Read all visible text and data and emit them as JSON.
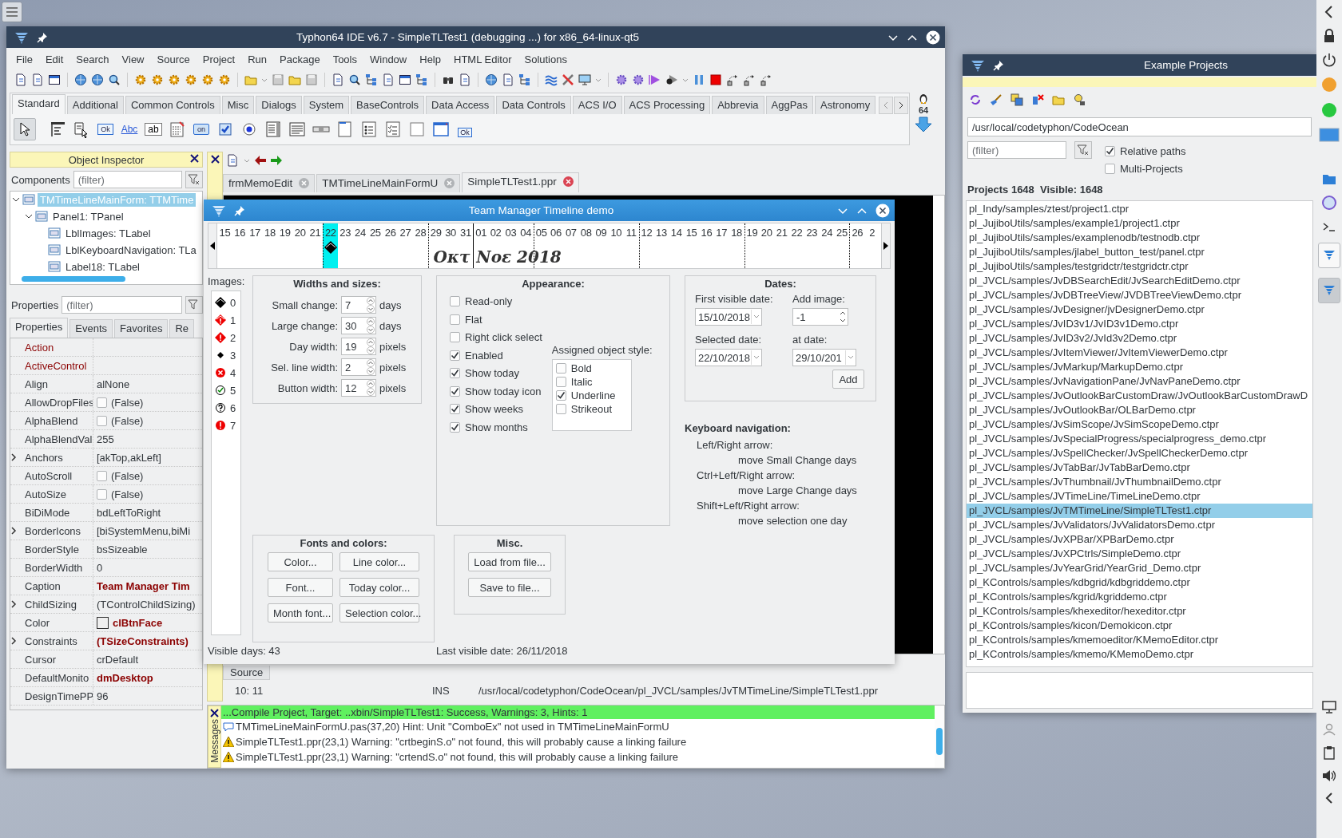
{
  "ide": {
    "title": "Typhon64 IDE v6.7 - SimpleTLTest1 (debugging ...) for x86_64-linux-qt5",
    "menu": [
      "File",
      "Edit",
      "Search",
      "View",
      "Source",
      "Project",
      "Run",
      "Package",
      "Tools",
      "Window",
      "Help",
      "HTML Editor",
      "Solutions"
    ],
    "palette_tabs": [
      {
        "label": "Standard",
        "selected": true
      },
      {
        "label": "Additional",
        "selected": false
      },
      {
        "label": "Common Controls",
        "selected": false
      },
      {
        "label": "Misc",
        "selected": false
      },
      {
        "label": "Dialogs",
        "selected": false
      },
      {
        "label": "System",
        "selected": false
      },
      {
        "label": "BaseControls",
        "selected": false
      },
      {
        "label": "Data Access",
        "selected": false
      },
      {
        "label": "Data Controls",
        "selected": false
      },
      {
        "label": "ACS I/O",
        "selected": false
      },
      {
        "label": "ACS Processing",
        "selected": false
      },
      {
        "label": "Abbrevia",
        "selected": false
      },
      {
        "label": "AggPas",
        "selected": false
      },
      {
        "label": "Astronomy",
        "selected": false
      }
    ],
    "palette_items": [
      {
        "kind": "pointer",
        "selected": true
      },
      {
        "kind": "menu",
        "selected": false
      },
      {
        "kind": "popup",
        "selected": false
      },
      {
        "kind": "button",
        "label": "Ok",
        "selected": false
      },
      {
        "kind": "text",
        "label": "Abc",
        "selected": false
      },
      {
        "kind": "edit",
        "label": "ab",
        "selected": false
      },
      {
        "kind": "memo",
        "selected": false
      },
      {
        "kind": "toggle",
        "label": "on",
        "selected": false
      },
      {
        "kind": "check",
        "selected": false
      },
      {
        "kind": "radio",
        "selected": false
      },
      {
        "kind": "listbox",
        "selected": false
      },
      {
        "kind": "combo",
        "selected": false
      },
      {
        "kind": "scrollbar",
        "selected": false
      },
      {
        "kind": "groupbox",
        "selected": false
      },
      {
        "kind": "radiogroup",
        "selected": false
      },
      {
        "kind": "checkgroup",
        "selected": false
      },
      {
        "kind": "panel",
        "selected": false
      },
      {
        "kind": "frame",
        "selected": false
      },
      {
        "kind": "actionlist",
        "label": "Ok",
        "selected": false
      }
    ],
    "target_badge": "64",
    "inspector": {
      "title": "Object Inspector",
      "components_label": "Components",
      "components_filter": {
        "placeholder": "(filter)"
      },
      "tree": [
        {
          "label": "TMTimeLineMainForm: TTMTime",
          "selected": true,
          "expanded": true,
          "children": [
            {
              "label": "Panel1: TPanel",
              "selected": false,
              "expanded": true,
              "children": [
                {
                  "label": "LblImages: TLabel",
                  "selected": false
                },
                {
                  "label": "LblKeyboardNavigation: TLa",
                  "selected": false
                },
                {
                  "label": "Label18: TLabel",
                  "selected": false
                }
              ]
            }
          ]
        }
      ],
      "properties_label": "Properties",
      "properties_filter": {
        "placeholder": "(filter)"
      },
      "tabs": [
        {
          "label": "Properties",
          "selected": true
        },
        {
          "label": "Events",
          "selected": false
        },
        {
          "label": "Favorites",
          "selected": false
        },
        {
          "label": "Re",
          "selected": false
        }
      ],
      "rows": [
        {
          "name": "Action",
          "kind": "empty",
          "special": true,
          "expandable": false
        },
        {
          "name": "ActiveControl",
          "kind": "empty",
          "special": true,
          "expandable": false
        },
        {
          "name": "Align",
          "kind": "text",
          "value": "alNone",
          "special": false,
          "expandable": false
        },
        {
          "name": "AllowDropFiles",
          "kind": "check",
          "checked": false,
          "value": "(False)",
          "special": false,
          "expandable": false
        },
        {
          "name": "AlphaBlend",
          "kind": "check",
          "checked": false,
          "value": "(False)",
          "special": false,
          "expandable": false
        },
        {
          "name": "AlphaBlendVal",
          "kind": "text",
          "value": "255",
          "special": false,
          "expandable": false
        },
        {
          "name": "Anchors",
          "kind": "text",
          "value": "[akTop,akLeft]",
          "special": false,
          "expandable": true
        },
        {
          "name": "AutoScroll",
          "kind": "check",
          "checked": false,
          "value": "(False)",
          "special": false,
          "expandable": false
        },
        {
          "name": "AutoSize",
          "kind": "check",
          "checked": false,
          "value": "(False)",
          "special": false,
          "expandable": false
        },
        {
          "name": "BiDiMode",
          "kind": "text",
          "value": "bdLeftToRight",
          "special": false,
          "expandable": false
        },
        {
          "name": "BorderIcons",
          "kind": "text",
          "value": "[biSystemMenu,biMi",
          "special": false,
          "expandable": true
        },
        {
          "name": "BorderStyle",
          "kind": "text",
          "value": "bsSizeable",
          "special": false,
          "expandable": false
        },
        {
          "name": "BorderWidth",
          "kind": "text",
          "value": "0",
          "special": false,
          "expandable": false
        },
        {
          "name": "Caption",
          "kind": "bold",
          "value": "Team Manager Tim",
          "special": false,
          "expandable": false
        },
        {
          "name": "ChildSizing",
          "kind": "text",
          "value": "(TControlChildSizing)",
          "special": false,
          "expandable": true
        },
        {
          "name": "Color",
          "kind": "color",
          "value": "clBtnFace",
          "special": false,
          "expandable": false
        },
        {
          "name": "Constraints",
          "kind": "bold",
          "value": "(TSizeConstraints)",
          "special": false,
          "expandable": true
        },
        {
          "name": "Cursor",
          "kind": "text",
          "value": "crDefault",
          "special": false,
          "expandable": false
        },
        {
          "name": "DefaultMonito",
          "kind": "bold",
          "value": "dmDesktop",
          "special": false,
          "expandable": false
        },
        {
          "name": "DesignTimePP",
          "kind": "text",
          "value": "96",
          "special": false,
          "expandable": false
        }
      ]
    },
    "editor": {
      "tabs": [
        {
          "label": "frmMemoEdit",
          "selected": false
        },
        {
          "label": "TMTimeLineMainFormU",
          "selected": false
        },
        {
          "label": "SimpleTLTest1.ppr",
          "selected": true
        }
      ],
      "source_tab": "Source",
      "status": {
        "position": "10: 11",
        "mode": "INS",
        "path": "/usr/local/codetyphon/CodeOcean/pl_JVCL/samples/JvTMTimeLine/SimpleTLTest1.ppr"
      }
    },
    "messages": {
      "title": "Messages",
      "summary": "...Compile Project, Target: ..xbin/SimpleTLTest1: Success, Warnings: 3, Hints: 1",
      "items": [
        {
          "kind": "hint",
          "text": "TMTimeLineMainFormU.pas(37,20) Hint: Unit \"ComboEx\" not used in TMTimeLineMainFormU"
        },
        {
          "kind": "warning",
          "text": "SimpleTLTest1.ppr(23,1) Warning: \"crtbeginS.o\" not found, this will probably cause a linking failure"
        },
        {
          "kind": "warning",
          "text": "SimpleTLTest1.ppr(23,1) Warning: \"crtendS.o\" not found, this will probably cause a linking failure"
        }
      ]
    }
  },
  "dialog": {
    "title": "Team Manager Timeline demo",
    "timeline": {
      "months": [
        {
          "label": "Οκτ",
          "days": [
            {
              "label": "15",
              "selected": false
            },
            {
              "label": "16",
              "selected": false
            },
            {
              "label": "17",
              "selected": false
            },
            {
              "label": "18",
              "selected": false
            },
            {
              "label": "19",
              "selected": false
            },
            {
              "label": "20",
              "selected": false
            },
            {
              "label": "21",
              "selected": false
            },
            {
              "label": "22",
              "selected": true
            },
            {
              "label": "23",
              "selected": false
            },
            {
              "label": "24",
              "selected": false
            },
            {
              "label": "25",
              "selected": false
            },
            {
              "label": "26",
              "selected": false
            },
            {
              "label": "27",
              "selected": false
            },
            {
              "label": "28",
              "selected": false
            },
            {
              "label": "29",
              "selected": false
            },
            {
              "label": "30",
              "selected": false
            },
            {
              "label": "31",
              "selected": false
            }
          ]
        },
        {
          "label": "Νοε 2018",
          "days": [
            {
              "label": "01",
              "selected": false
            },
            {
              "label": "02",
              "selected": false
            },
            {
              "label": "03",
              "selected": false
            },
            {
              "label": "04",
              "selected": false
            },
            {
              "label": "05",
              "selected": false
            },
            {
              "label": "06",
              "selected": false
            },
            {
              "label": "07",
              "selected": false
            },
            {
              "label": "08",
              "selected": false
            },
            {
              "label": "09",
              "selected": false
            },
            {
              "label": "10",
              "selected": false
            },
            {
              "label": "11",
              "selected": false
            },
            {
              "label": "12",
              "selected": false
            },
            {
              "label": "13",
              "selected": false
            },
            {
              "label": "14",
              "selected": false
            },
            {
              "label": "15",
              "selected": false
            },
            {
              "label": "16",
              "selected": false
            },
            {
              "label": "17",
              "selected": false
            },
            {
              "label": "18",
              "selected": false
            },
            {
              "label": "19",
              "selected": false
            },
            {
              "label": "20",
              "selected": false
            },
            {
              "label": "21",
              "selected": false
            },
            {
              "label": "22",
              "selected": false
            },
            {
              "label": "23",
              "selected": false
            },
            {
              "label": "24",
              "selected": false
            },
            {
              "label": "25",
              "selected": false
            },
            {
              "label": "26",
              "selected": false
            },
            {
              "label": "2",
              "selected": false
            }
          ]
        }
      ]
    },
    "images_label": "Images:",
    "images": [
      "0",
      "1",
      "2",
      "3",
      "4",
      "5",
      "6",
      "7"
    ],
    "widths": {
      "title": "Widths and sizes:",
      "rows": [
        {
          "label": "Small change:",
          "value": "7",
          "unit": "days"
        },
        {
          "label": "Large change:",
          "value": "30",
          "unit": "days"
        },
        {
          "label": "Day width:",
          "value": "19",
          "unit": "pixels"
        },
        {
          "label": "Sel. line width:",
          "value": "2",
          "unit": "pixels"
        },
        {
          "label": "Button width:",
          "value": "12",
          "unit": "pixels"
        }
      ]
    },
    "appearance": {
      "title": "Appearance:",
      "options": [
        {
          "label": "Read-only",
          "checked": false
        },
        {
          "label": "Flat",
          "checked": false
        },
        {
          "label": "Right click select",
          "checked": false
        },
        {
          "label": "Enabled",
          "checked": true
        },
        {
          "label": "Show today",
          "checked": true
        },
        {
          "label": "Show today icon",
          "checked": true
        },
        {
          "label": "Show weeks",
          "checked": true
        },
        {
          "label": "Show months",
          "checked": true
        }
      ],
      "style_label": "Assigned object style:",
      "styles": [
        {
          "label": "Bold",
          "checked": false
        },
        {
          "label": "Italic",
          "checked": false
        },
        {
          "label": "Underline",
          "checked": true
        },
        {
          "label": "Strikeout",
          "checked": false
        }
      ]
    },
    "dates": {
      "title": "Dates:",
      "first_label": "First visible date:",
      "first_value": "15/10/2018",
      "add_image_label": "Add image:",
      "add_image_value": "-1",
      "selected_label": "Selected date:",
      "selected_value": "22/10/2018",
      "at_label": "at date:",
      "at_value": "29/10/201",
      "add_button": "Add"
    },
    "keyboard": {
      "title": "Keyboard navigation:",
      "items": [
        {
          "key": "Left/Right arrow:",
          "action": "move Small Change days"
        },
        {
          "key": "Ctrl+Left/Right arrow:",
          "action": "move Large Change days"
        },
        {
          "key": "Shift+Left/Right arrow:",
          "action": "move selection one day"
        }
      ]
    },
    "fonts": {
      "title": "Fonts and colors:",
      "buttons": [
        "Color...",
        "Line color...",
        "Font...",
        "Today color...",
        "Month font...",
        "Selection color..."
      ]
    },
    "misc": {
      "title": "Misc.",
      "buttons": [
        "Load from file...",
        "Save to file..."
      ]
    },
    "footer": {
      "visible_days": "Visible days: 43",
      "last_visible": "Last visible date: 26/11/2018"
    }
  },
  "projects": {
    "title": "Example Projects",
    "path": "/usr/local/codetyphon/CodeOcean",
    "filter": {
      "placeholder": "(filter)"
    },
    "options": [
      {
        "label": "Relative paths",
        "checked": true
      },
      {
        "label": "Multi-Projects",
        "checked": false
      }
    ],
    "stats": "Projects 1648  Visible: 1648",
    "items": [
      {
        "label": "pl_Indy/samples/ztest/project1.ctpr",
        "selected": false
      },
      {
        "label": "pl_JujiboUtils/samples/example1/project1.ctpr",
        "selected": false
      },
      {
        "label": "pl_JujiboUtils/samples/examplenodb/testnodb.ctpr",
        "selected": false
      },
      {
        "label": "pl_JujiboUtils/samples/jlabel_button_test/panel.ctpr",
        "selected": false
      },
      {
        "label": "pl_JujiboUtils/samples/testgridctr/testgridctr.ctpr",
        "selected": false
      },
      {
        "label": "pl_JVCL/samples/JvDBSearchEdit/JvSearchEditDemo.ctpr",
        "selected": false
      },
      {
        "label": "pl_JVCL/samples/JvDBTreeView/JVDBTreeViewDemo.ctpr",
        "selected": false
      },
      {
        "label": "pl_JVCL/samples/JvDesigner/jvDesignerDemo.ctpr",
        "selected": false
      },
      {
        "label": "pl_JVCL/samples/JvID3v1/JvID3v1Demo.ctpr",
        "selected": false
      },
      {
        "label": "pl_JVCL/samples/JvID3v2/JvId3v2Demo.ctpr",
        "selected": false
      },
      {
        "label": "pl_JVCL/samples/JvItemViewer/JvItemViewerDemo.ctpr",
        "selected": false
      },
      {
        "label": "pl_JVCL/samples/JvMarkup/MarkupDemo.ctpr",
        "selected": false
      },
      {
        "label": "pl_JVCL/samples/JvNavigationPane/JvNavPaneDemo.ctpr",
        "selected": false
      },
      {
        "label": "pl_JVCL/samples/JvOutlookBarCustomDraw/JvOutlookBarCustomDrawD",
        "selected": false
      },
      {
        "label": "pl_JVCL/samples/JvOutlookBar/OLBarDemo.ctpr",
        "selected": false
      },
      {
        "label": "pl_JVCL/samples/JvSimScope/JvSimScopeDemo.ctpr",
        "selected": false
      },
      {
        "label": "pl_JVCL/samples/JvSpecialProgress/specialprogress_demo.ctpr",
        "selected": false
      },
      {
        "label": "pl_JVCL/samples/JvSpellChecker/JvSpellCheckerDemo.ctpr",
        "selected": false
      },
      {
        "label": "pl_JVCL/samples/JvTabBar/JvTabBarDemo.ctpr",
        "selected": false
      },
      {
        "label": "pl_JVCL/samples/JvThumbnail/JvThumbnailDemo.ctpr",
        "selected": false
      },
      {
        "label": "pl_JVCL/samples/JVTimeLine/TimeLineDemo.ctpr",
        "selected": false
      },
      {
        "label": "pl_JVCL/samples/JvTMTimeLine/SimpleTLTest1.ctpr",
        "selected": true
      },
      {
        "label": "pl_JVCL/samples/JvValidators/JvValidatorsDemo.ctpr",
        "selected": false
      },
      {
        "label": "pl_JVCL/samples/JvXPBar/XPBarDemo.ctpr",
        "selected": false
      },
      {
        "label": "pl_JVCL/samples/JvXPCtrls/SimpleDemo.ctpr",
        "selected": false
      },
      {
        "label": "pl_JVCL/samples/JvYearGrid/YearGrid_Demo.ctpr",
        "selected": false
      },
      {
        "label": "pl_KControls/samples/kdbgrid/kdbgriddemo.ctpr",
        "selected": false
      },
      {
        "label": "pl_KControls/samples/kgrid/kgriddemo.ctpr",
        "selected": false
      },
      {
        "label": "pl_KControls/samples/khexeditor/hexeditor.ctpr",
        "selected": false
      },
      {
        "label": "pl_KControls/samples/kicon/Demokicon.ctpr",
        "selected": false
      },
      {
        "label": "pl_KControls/samples/kmemoeditor/KMemoEditor.ctpr",
        "selected": false
      },
      {
        "label": "pl_KControls/samples/kmemo/KMemoDemo.ctpr",
        "selected": false
      }
    ]
  }
}
